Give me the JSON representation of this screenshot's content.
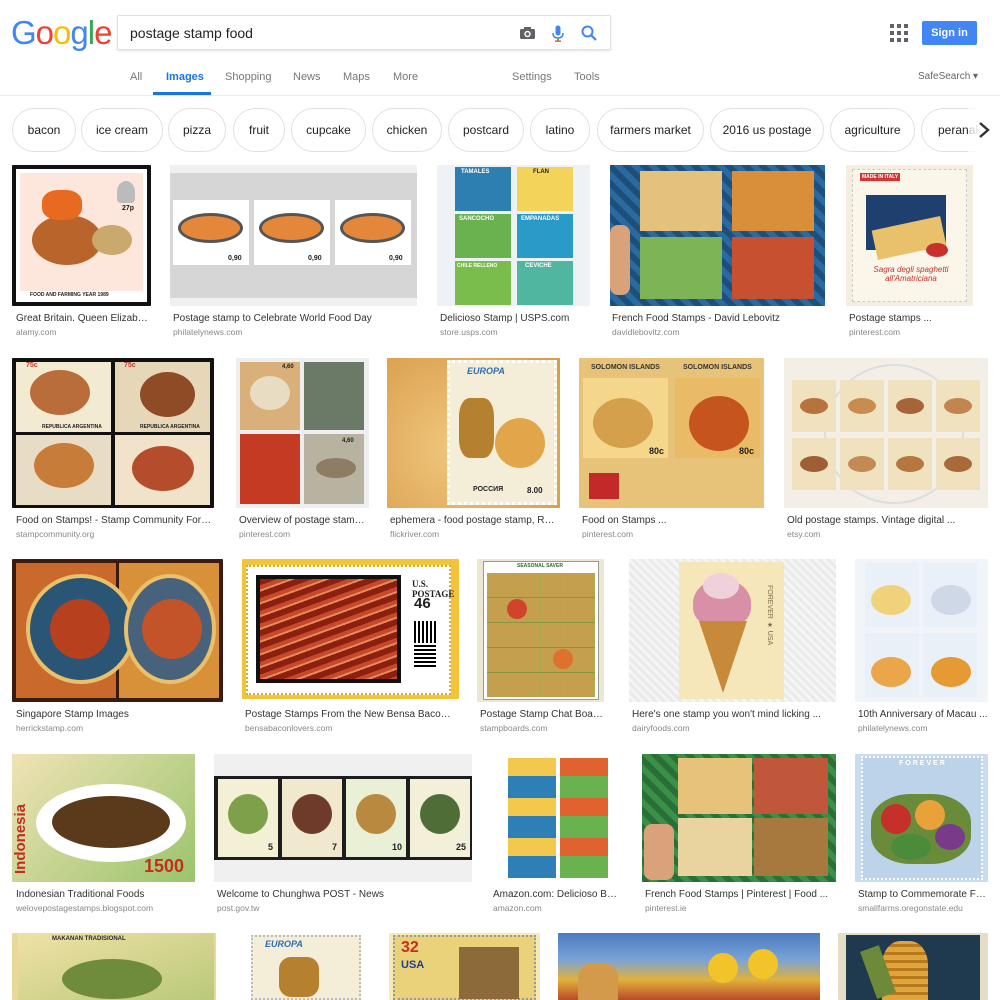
{
  "logo": {
    "letters": [
      "G",
      "o",
      "o",
      "g",
      "l",
      "e"
    ],
    "colors": [
      "#4285f4",
      "#ea4335",
      "#fbbc05",
      "#4285f4",
      "#34a853",
      "#ea4335"
    ]
  },
  "search": {
    "query": "postage stamp food"
  },
  "header": {
    "signin_label": "Sign in"
  },
  "nav": {
    "items": [
      "All",
      "Images",
      "Shopping",
      "News",
      "Maps",
      "More"
    ],
    "active": "Images",
    "settings": "Settings",
    "tools": "Tools",
    "safesearch": "SafeSearch ▾"
  },
  "chips": [
    "bacon",
    "ice cream",
    "pizza",
    "fruit",
    "cupcake",
    "chicken",
    "postcard",
    "latino",
    "farmers market",
    "2016 us postage",
    "agriculture",
    "peranakan"
  ],
  "results": [
    {
      "title": "Great Britain. Queen Elizabet...",
      "source": "alamy.com",
      "stamp_text": [
        "FOOD AND FARMING YEAR 1989",
        "27p"
      ]
    },
    {
      "title": "Postage stamp to Celebrate World Food Day",
      "source": "philatelynews.com",
      "stamp_text": [
        "0,90",
        "0,90",
        "0,90"
      ]
    },
    {
      "title": "Delicioso Stamp | USPS.com",
      "source": "store.usps.com",
      "stamp_text": [
        "TAMALES",
        "FLAN",
        "SANCOCHO",
        "EMPANADAS",
        "CHILE RELLENO",
        "CEVICHE"
      ]
    },
    {
      "title": "French Food Stamps - David Lebovitz",
      "source": "davidlebovitz.com",
      "stamp_text": []
    },
    {
      "title": "Postage stamps ...",
      "source": "pinterest.com",
      "stamp_text": [
        "MADE IN ITALY",
        "Sagra degli spaghetti all'Amatriciana"
      ]
    },
    {
      "title": "Food on Stamps! - Stamp Community Forum...",
      "source": "stampcommunity.org",
      "stamp_text": [
        "REPUBLICA ARGENTINA",
        "75c"
      ]
    },
    {
      "title": "Overview of postage stamp...",
      "source": "pinterest.com",
      "stamp_text": [
        "4,60",
        "4,60"
      ]
    },
    {
      "title": "ephemera - food postage stamp, Rus...",
      "source": "flickriver.com",
      "stamp_text": [
        "EUROPA",
        "РОССИЯ",
        "8.00"
      ]
    },
    {
      "title": "Food on Stamps ...",
      "source": "pinterest.com",
      "stamp_text": [
        "SOLOMON ISLANDS",
        "80c"
      ]
    },
    {
      "title": "Old postage stamps. Vintage digital ...",
      "source": "etsy.com",
      "stamp_text": []
    },
    {
      "title": "Singapore Stamp Images",
      "source": "herrickstamp.com",
      "stamp_text": []
    },
    {
      "title": "Postage Stamps From the New Bensa Bacon ...",
      "source": "bensabaconlovers.com",
      "stamp_text": [
        "U.S. POSTAGE",
        "46"
      ]
    },
    {
      "title": "Postage Stamp Chat Board ...",
      "source": "stampboards.com",
      "stamp_text": [
        "SEASONAL SAVER"
      ]
    },
    {
      "title": "Here's one stamp you won't mind licking ...",
      "source": "dairyfoods.com",
      "stamp_text": [
        "FOREVER ★ USA"
      ]
    },
    {
      "title": "10th Anniversary of Macau ...",
      "source": "philatelynews.com",
      "stamp_text": []
    },
    {
      "title": "Indonesian Traditional Foods",
      "source": "welovepostagestamps.blogspot.com",
      "stamp_text": [
        "Indonesia",
        "1500"
      ]
    },
    {
      "title": "Welcome to Chunghwa POST - News",
      "source": "post.gov.tw",
      "stamp_text": [
        "5",
        "7",
        "10",
        "25"
      ]
    },
    {
      "title": "Amazon.com: Delicioso Bo...",
      "source": "amazon.com",
      "stamp_text": []
    },
    {
      "title": "French Food Stamps | Pinterest | Food ...",
      "source": "pinterest.ie",
      "stamp_text": []
    },
    {
      "title": "Stamp to Commemorate Fa...",
      "source": "smallfarms.oregonstate.edu",
      "stamp_text": [
        "FOREVER"
      ]
    },
    {
      "title": "",
      "source": "",
      "stamp_text": [
        "MAKANAN TRADISIONAL"
      ]
    },
    {
      "title": "",
      "source": "",
      "stamp_text": [
        "EUROPA"
      ]
    },
    {
      "title": "",
      "source": "",
      "stamp_text": [
        "32",
        "USA"
      ]
    },
    {
      "title": "",
      "source": "",
      "stamp_text": []
    },
    {
      "title": "",
      "source": "",
      "stamp_text": []
    }
  ],
  "colors": {
    "accent": "#1a73e8",
    "signin": "#4285f4"
  }
}
